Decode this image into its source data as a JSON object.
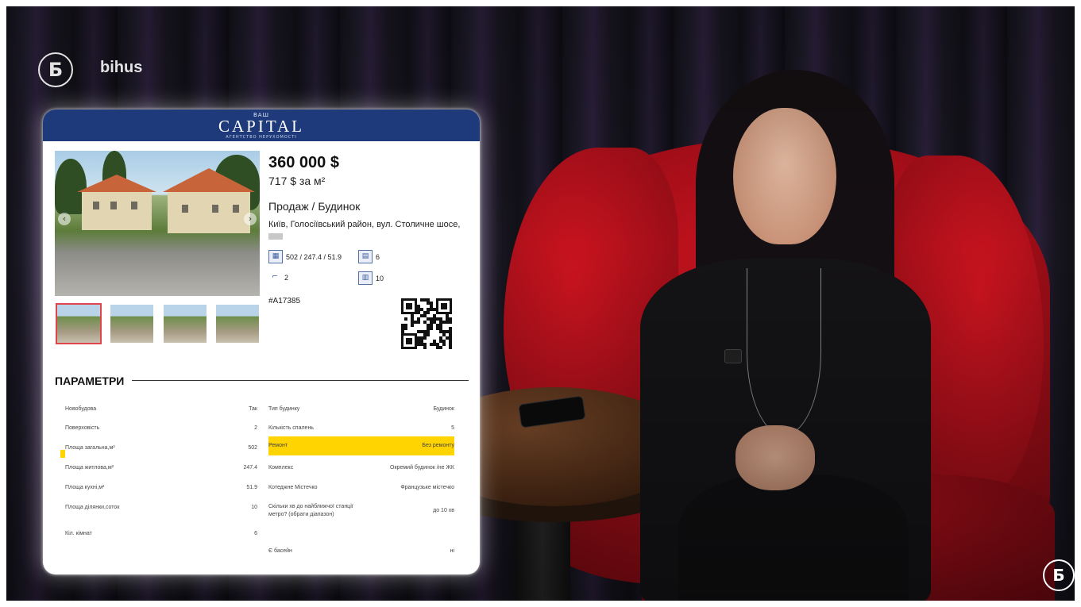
{
  "channel": {
    "logo_glyph": "Б",
    "name": "bihus"
  },
  "listing": {
    "brand": {
      "small_top": "ВАШ",
      "name": "CAPITAL",
      "tagline": "АГЕНТСТВО НЕРУХОМОСТІ"
    },
    "price": "360 000 $",
    "price_per_sqm": "717 $ за м²",
    "deal_type": "Продаж / Будинок",
    "address": "Київ, Голосіївський район, вул. Столичне шосе,",
    "specs": {
      "area": "502 / 247.4 / 51.9",
      "rooms": "6",
      "floors": "2",
      "land": "10"
    },
    "id": "#A17385",
    "params_title": "ПАРАМЕТРИ",
    "params_left": [
      {
        "label": "Новобудова",
        "value": "Так"
      },
      {
        "label": "Поверховість",
        "value": "2"
      },
      {
        "label": "Площа загальна,м²",
        "value": "502"
      },
      {
        "label": "Площа житлова,м²",
        "value": "247.4"
      },
      {
        "label": "Площа кухні,м²",
        "value": "51.9"
      },
      {
        "label": "Площа ділянки,соток",
        "value": "10"
      },
      {
        "label": "Кіл. кімнат",
        "value": "6"
      }
    ],
    "params_right": [
      {
        "label": "Тип будинку",
        "value": "Будинок"
      },
      {
        "label": "Кількість спалень",
        "value": "5"
      },
      {
        "label": "Ремонт",
        "value": "Без ремонту"
      },
      {
        "label": "Комплекс",
        "value": "Окремий будинок /не ЖК"
      },
      {
        "label": "Котеджне Містечко",
        "value": "Французьке містечко"
      },
      {
        "label": "Скільки хв до найближчої станції метро? (обрати діапазон)",
        "value": "до 10 хв"
      },
      {
        "label": "Є басейн",
        "value": "ні"
      }
    ]
  },
  "colors": {
    "header": "#1f3a7a",
    "highlight": "#ffd400",
    "chair": "#c8141f"
  }
}
